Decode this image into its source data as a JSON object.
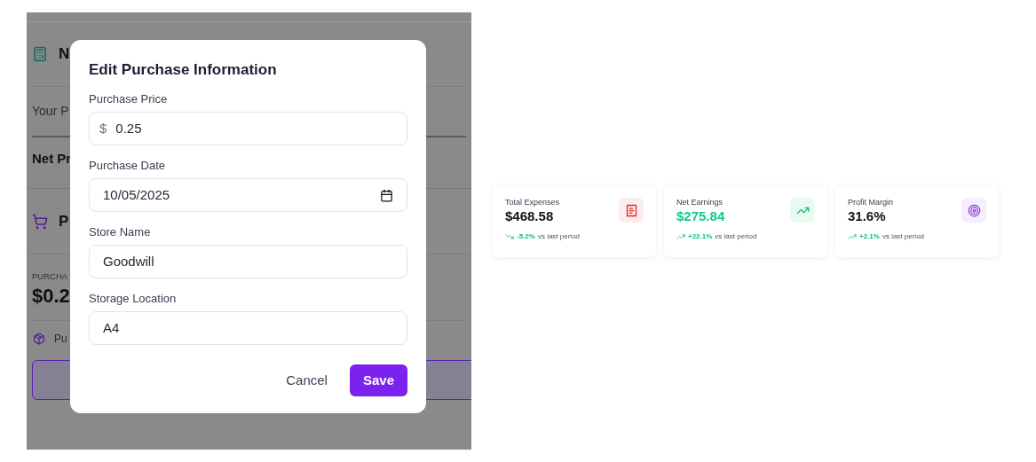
{
  "background": {
    "net_section": {
      "title": "N",
      "your_label": "Your P",
      "net_label": "Net Pr"
    },
    "purchase_section": {
      "title": "P",
      "caption": "PURCHA",
      "amount": "$0.2",
      "item_label": "Pu"
    }
  },
  "dialog": {
    "title": "Edit Purchase Information",
    "fields": [
      {
        "kind": "money",
        "label": "Purchase Price",
        "prefix": "$",
        "value": "0.25"
      },
      {
        "kind": "date",
        "label": "Purchase Date",
        "value": "10/05/2025"
      },
      {
        "kind": "text",
        "label": "Store Name",
        "value": "Goodwill"
      },
      {
        "kind": "text",
        "label": "Storage Location",
        "value": "A4"
      }
    ],
    "buttons": [
      {
        "kind": "plain",
        "label": "Cancel"
      },
      {
        "kind": "primary",
        "label": "Save"
      }
    ]
  },
  "stats": [
    {
      "title": "Total Expenses",
      "value": "$468.58",
      "highlight": false,
      "kind": "expenses",
      "rising": false,
      "change": "-5.2%",
      "note": "vs last period"
    },
    {
      "title": "Net Earnings",
      "value": "$275.84",
      "highlight": true,
      "kind": "earnings",
      "rising": true,
      "change": "+22.1%",
      "note": "vs last period"
    },
    {
      "title": "Profit Margin",
      "value": "31.6%",
      "highlight": false,
      "kind": "margin",
      "rising": true,
      "change": "+2.1%",
      "note": "vs last period"
    }
  ]
}
